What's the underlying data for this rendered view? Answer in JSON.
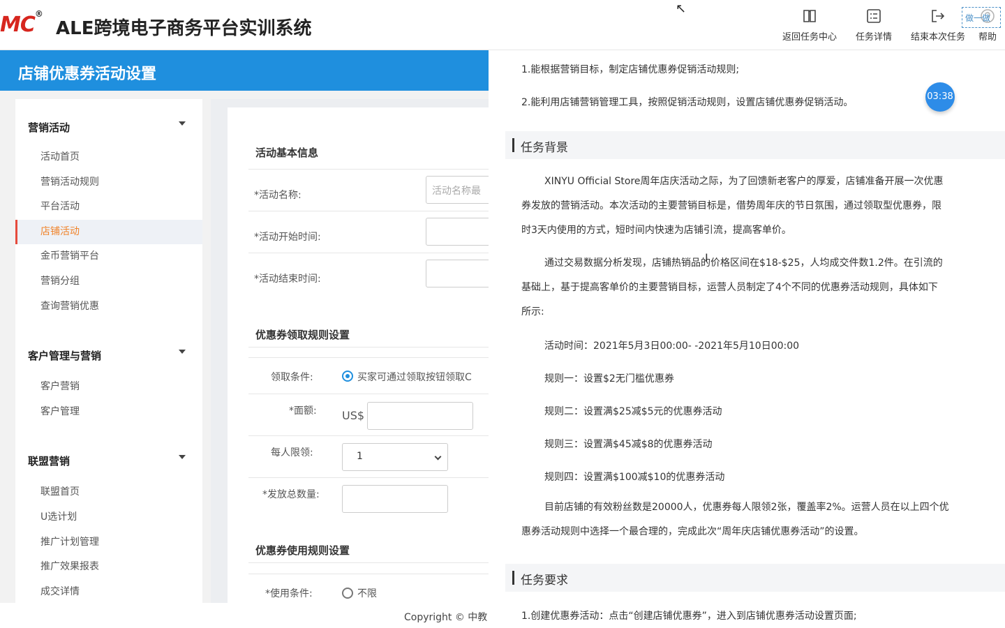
{
  "header": {
    "logo_text": "MC",
    "logo_reg": "®",
    "title": "ALE跨境电子商务平台实训系统",
    "toolbar": [
      {
        "label": "返回任务中心",
        "icon": "book-icon"
      },
      {
        "label": "任务详情",
        "icon": "list-card-icon"
      },
      {
        "label": "结束本次任务",
        "icon": "exit-icon"
      },
      {
        "label": "帮助",
        "icon": "help-icon"
      }
    ],
    "overlay_note": "做一做"
  },
  "banner": {
    "title": "店铺优惠券活动设置"
  },
  "sidebar": {
    "groups": [
      {
        "title": "营销活动",
        "items": [
          "活动首页",
          "营销活动规则",
          "平台活动",
          "店铺活动",
          "金币营销平台",
          "营销分组",
          "查询营销优惠"
        ],
        "active": "店铺活动"
      },
      {
        "title": "客户管理与营销",
        "items": [
          "客户营销",
          "客户管理"
        ]
      },
      {
        "title": "联盟营销",
        "items": [
          "联盟首页",
          "U选计划",
          "推广计划管理",
          "推广效果报表",
          "成交详情"
        ]
      }
    ]
  },
  "form": {
    "basic_title": "活动基本信息",
    "name_label": "*活动名称:",
    "name_placeholder": "活动名称最",
    "start_label": "*活动开始时间:",
    "end_label": "*活动结束时间:",
    "claim_title": "优惠券领取规则设置",
    "claim_cond_label": "领取条件:",
    "claim_cond_option": "买家可通过领取按钮领取C",
    "face_label": "*面额:",
    "currency": "US$",
    "limit_label": "每人限领:",
    "limit_value": "1",
    "total_label": "*发放总数量:",
    "use_title": "优惠券使用规则设置",
    "use_cond_label": "*使用条件:",
    "use_cond_option": "不限"
  },
  "footer": {
    "copyright": "Copyright © 中教"
  },
  "panel": {
    "goals": [
      "1.能根据营销目标，制定店铺优惠券促销活动规则;",
      "2.能利用店铺营销管理工具，按照促销活动规则，设置店铺优惠券促销活动。"
    ],
    "timer": "03:38",
    "background_title": "任务背景",
    "bg_para1": [
      "XINYU Official Store周年店庆活动之际，为了回馈新老客户的厚爱，店铺准备开展一次优惠",
      "券发放的营销活动。本次活动的主要营销目标是，借势周年庆的节日氛围，通过领取型优惠券，限",
      "时3天内使用的方式，短时间内快速为店铺引流，提高客单价。"
    ],
    "bg_para2": [
      "通过交易数据分析发现，店铺热销品的价格区间在$18-$25，人均成交件数1.2件。在引流的",
      "基础上，基于提高客单价的主要营销目标，运营人员制定了4个不同的优惠券活动规则，具体如下",
      "所示:"
    ],
    "activity_time": "活动时间：2021年5月3日00:00- -2021年5月10日00:00",
    "rules": [
      "规则一：设置$2无门槛优惠券",
      "规则二：设置满$25减$5元的优惠券活动",
      "规则三：设置满$45减$8的优惠券活动",
      "规则四：设置满$100减$10的优惠券活动"
    ],
    "bg_para3": [
      "目前店铺的有效粉丝数是20000人，优惠券每人限领2张，覆盖率2%。运营人员在以上四个优",
      "惠券活动规则中选择一个最合理的，完成此次“周年庆店铺优惠券活动”的设置。"
    ],
    "requirement_title": "任务要求",
    "requirement_1": "1.创建优惠券活动：点击“创建店铺优惠券”，进入到店铺优惠券活动设置页面;"
  }
}
